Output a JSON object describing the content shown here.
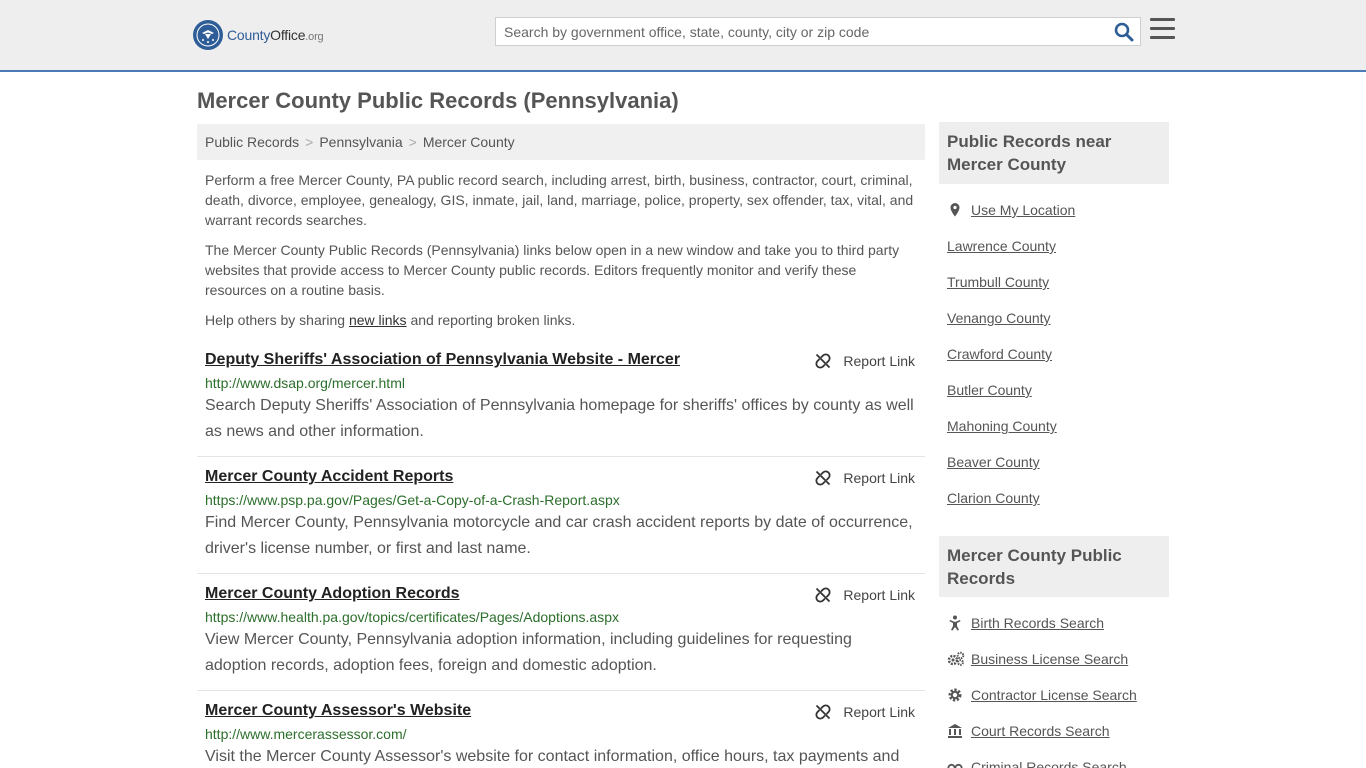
{
  "header": {
    "logo_county": "County",
    "logo_office": "Office",
    "logo_tld": ".org",
    "search_placeholder": "Search by government office, state, county, city or zip code"
  },
  "page": {
    "title": "Mercer County Public Records (Pennsylvania)",
    "breadcrumbs": [
      "Public Records",
      "Pennsylvania",
      "Mercer County"
    ],
    "breadcrumb_sep": ">",
    "intro1": "Perform a free Mercer County, PA public record search, including arrest, birth, business, contractor, court, criminal, death, divorce, employee, genealogy, GIS, inmate, jail, land, marriage, police, property, sex offender, tax, vital, and warrant records searches.",
    "intro2": "The Mercer County Public Records (Pennsylvania) links below open in a new window and take you to third party websites that provide access to Mercer County public records. Editors frequently monitor and verify these resources on a routine basis.",
    "help_pre": "Help others by sharing ",
    "help_link": "new links",
    "help_post": " and reporting broken links."
  },
  "records": [
    {
      "title": "Deputy Sheriffs' Association of Pennsylvania Website - Mercer",
      "url": "http://www.dsap.org/mercer.html",
      "desc": "Search Deputy Sheriffs' Association of Pennsylvania homepage for sheriffs' offices by county as well as news and other information.",
      "report": "Report Link"
    },
    {
      "title": "Mercer County Accident Reports",
      "url": "https://www.psp.pa.gov/Pages/Get-a-Copy-of-a-Crash-Report.aspx",
      "desc": "Find Mercer County, Pennsylvania motorcycle and car crash accident reports by date of occurrence, driver's license number, or first and last name.",
      "report": "Report Link"
    },
    {
      "title": "Mercer County Adoption Records",
      "url": "https://www.health.pa.gov/topics/certificates/Pages/Adoptions.aspx",
      "desc": "View Mercer County, Pennsylvania adoption information, including guidelines for requesting adoption records, adoption fees, foreign and domestic adoption.",
      "report": "Report Link"
    },
    {
      "title": "Mercer County Assessor's Website",
      "url": "http://www.mercerassessor.com/",
      "desc": "Visit the Mercer County Assessor's website for contact information, office hours, tax payments and",
      "report": "Report Link"
    }
  ],
  "sidebar": {
    "nearby_title": "Public Records near Mercer County",
    "use_location": "Use My Location",
    "nearby": [
      "Lawrence County",
      "Trumbull County",
      "Venango County",
      "Crawford County",
      "Butler County",
      "Mahoning County",
      "Beaver County",
      "Clarion County"
    ],
    "county_title": "Mercer County Public Records",
    "county_links": [
      {
        "label": "Birth Records Search",
        "icon": "baby-icon"
      },
      {
        "label": "Business License Search",
        "icon": "gears-icon"
      },
      {
        "label": "Contractor License Search",
        "icon": "gear-icon"
      },
      {
        "label": "Court Records Search",
        "icon": "courthouse-icon"
      },
      {
        "label": "Criminal Records Search",
        "icon": "handcuffs-icon"
      }
    ]
  },
  "colors": {
    "accent": "#4a7bb7",
    "brand": "#2f5d97",
    "url_green": "#2c6e2c"
  }
}
